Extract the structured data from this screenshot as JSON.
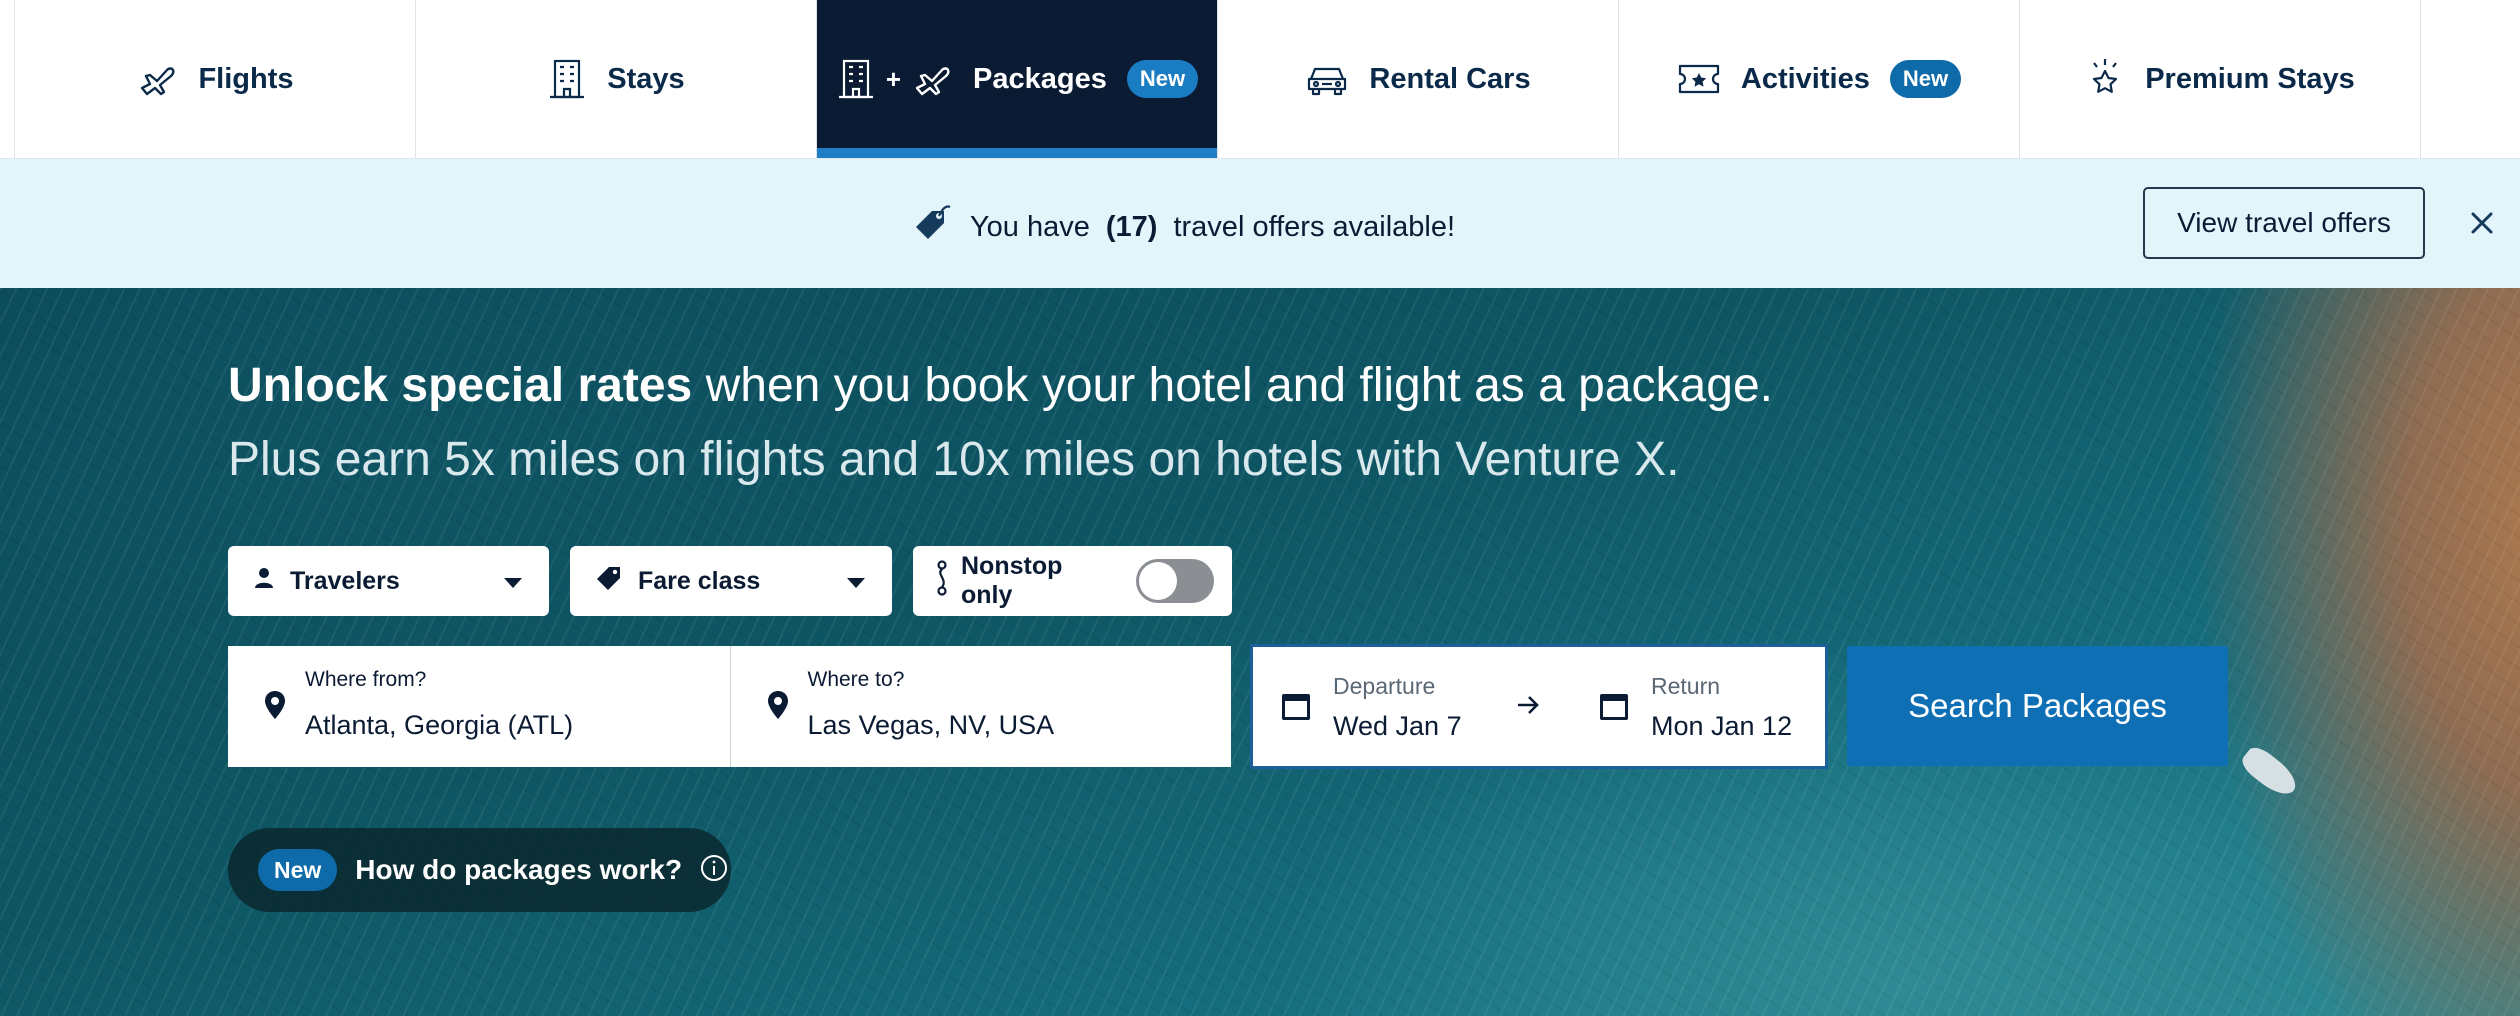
{
  "tabs": [
    {
      "label": "Flights",
      "icon": "plane-icon",
      "badge": ""
    },
    {
      "label": "Stays",
      "icon": "hotel-icon",
      "badge": ""
    },
    {
      "label": "Packages",
      "icon": "hotel-plus-plane-icon",
      "badge": "New"
    },
    {
      "label": "Rental Cars",
      "icon": "car-icon",
      "badge": ""
    },
    {
      "label": "Activities",
      "icon": "ticket-icon",
      "badge": "New"
    },
    {
      "label": "Premium Stays",
      "icon": "sparkle-star-icon",
      "badge": ""
    }
  ],
  "active_tab": "Packages",
  "banner": {
    "prefix": "You have",
    "count": "(17)",
    "suffix": "travel offers available!",
    "button": "View travel offers",
    "icon": "price-tag-icon"
  },
  "hero": {
    "headline_bold": "Unlock special rates",
    "headline_rest": "when you book your hotel and flight as a package.",
    "subline": "Plus earn 5x miles on flights and 10x miles on hotels with Venture X."
  },
  "filters": {
    "travelers": "Travelers",
    "fare_class": "Fare class",
    "nonstop": "Nonstop only",
    "nonstop_enabled": false
  },
  "search": {
    "from_label": "Where from?",
    "from_value": "Atlanta, Georgia (ATL)",
    "to_label": "Where to?",
    "to_value": "Las Vegas, NV, USA",
    "departure_label": "Departure",
    "departure_value": "Wed Jan 7",
    "return_label": "Return",
    "return_value": "Mon Jan 12",
    "button": "Search Packages"
  },
  "info": {
    "badge": "New",
    "text": "How do packages work?"
  },
  "colors": {
    "navy": "#0b1b33",
    "accent_blue": "#0e6fb5",
    "badge_blue": "#0e6aa8",
    "banner_bg": "#e4f4fb"
  }
}
